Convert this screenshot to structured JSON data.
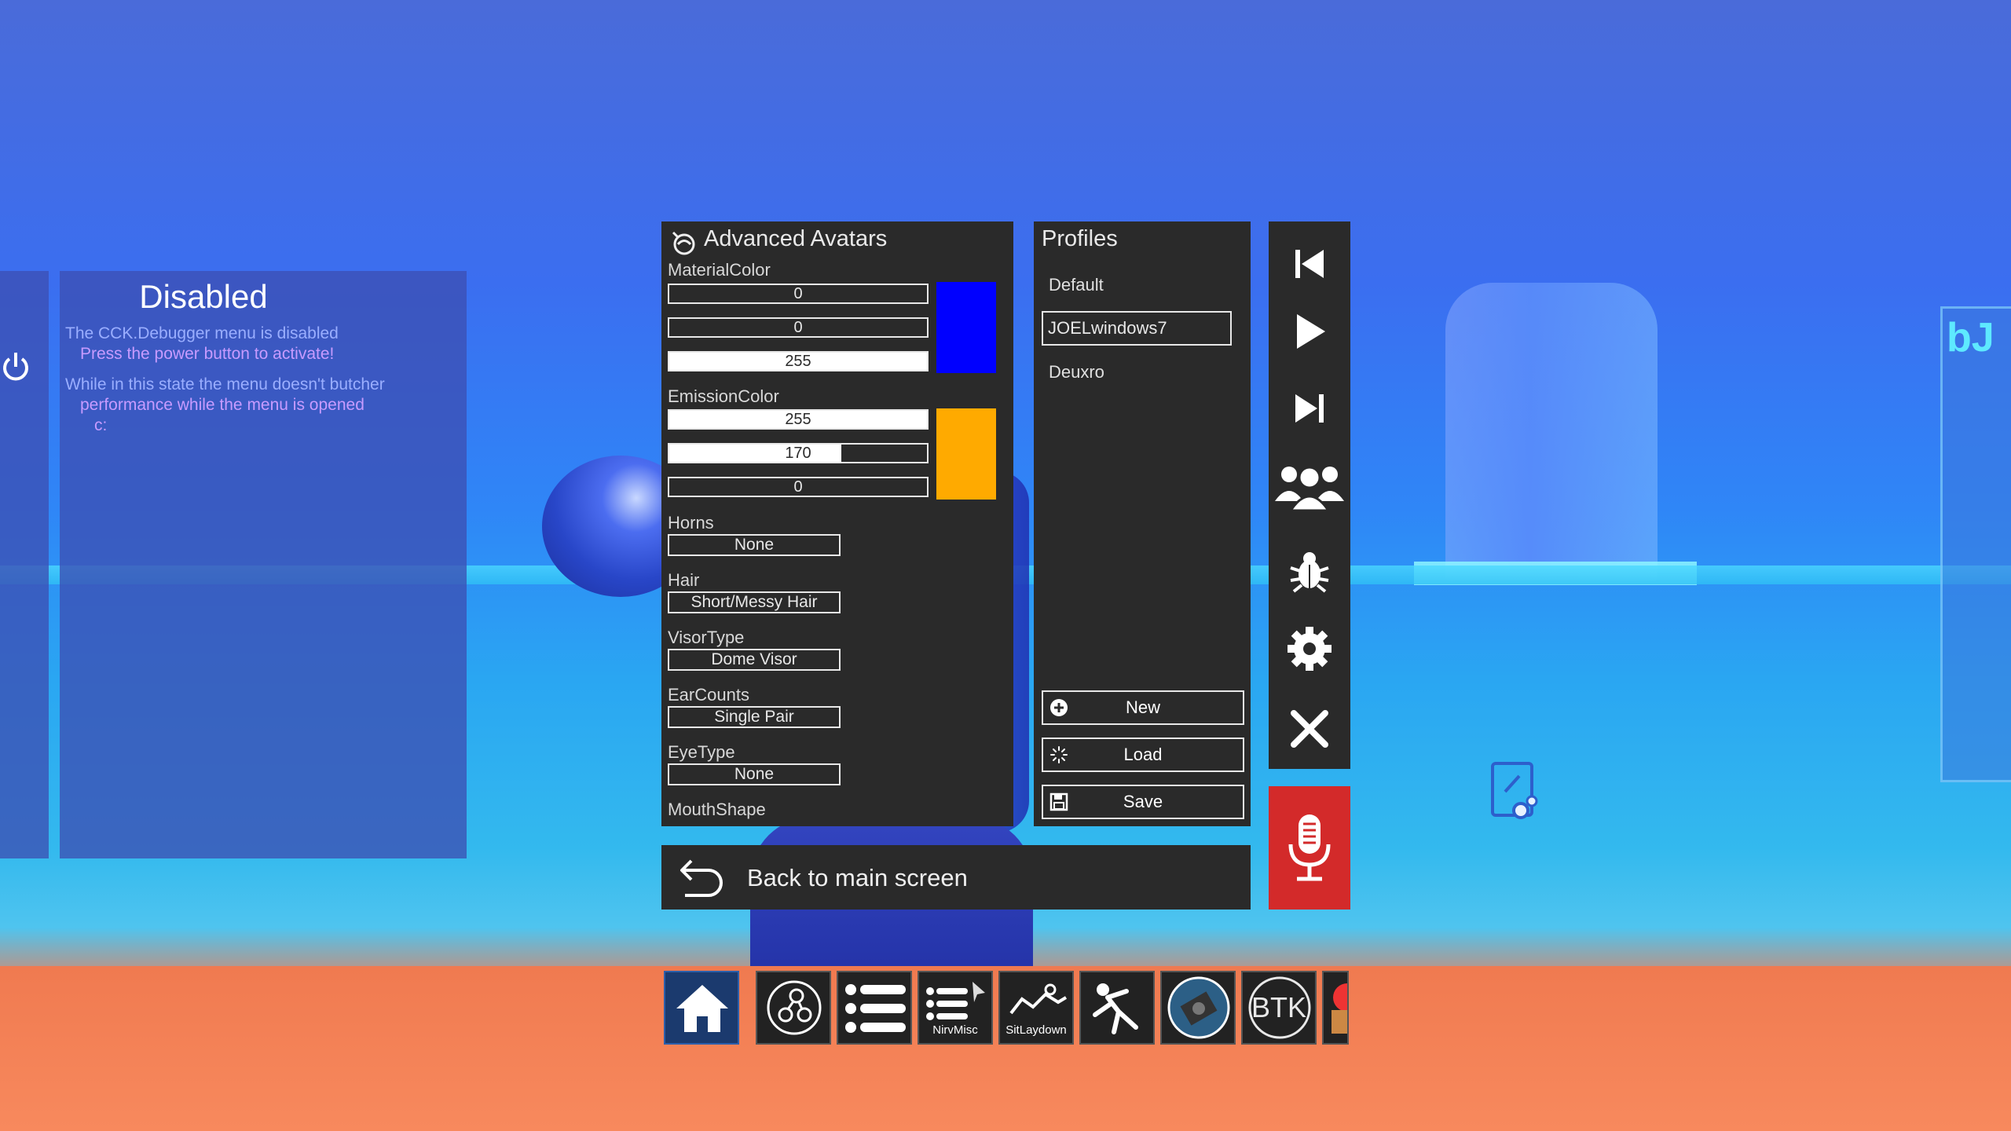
{
  "debugger": {
    "title": "Disabled",
    "line1": "The CCK.Debugger menu is disabled",
    "line2": "Press the power button to activate!",
    "line3": "While in this state the menu doesn't butcher",
    "line4": "performance while the menu is opened",
    "line5": "c:"
  },
  "advanced_avatars": {
    "title": "Advanced Avatars",
    "material_color": {
      "label": "MaterialColor",
      "r": "0",
      "g": "0",
      "b": "255",
      "r_frac": 0,
      "g_frac": 0,
      "b_frac": 1.0,
      "swatch": "#0000ff"
    },
    "emission_color": {
      "label": "EmissionColor",
      "r": "255",
      "g": "170",
      "b": "0",
      "r_frac": 1.0,
      "g_frac": 0.667,
      "b_frac": 0,
      "swatch": "#ffaa00"
    },
    "horns": {
      "label": "Horns",
      "value": "None"
    },
    "hair": {
      "label": "Hair",
      "value": "Short/Messy Hair"
    },
    "visor": {
      "label": "VisorType",
      "value": "Dome Visor"
    },
    "ears": {
      "label": "EarCounts",
      "value": "Single Pair"
    },
    "eye": {
      "label": "EyeType",
      "value": "None"
    },
    "mouth": {
      "label": "MouthShape"
    }
  },
  "profiles": {
    "title": "Profiles",
    "items": [
      "Default",
      "JOELwindows7",
      "Deuxro"
    ],
    "new_label": "New",
    "load_label": "Load",
    "save_label": "Save"
  },
  "back": {
    "label": "Back to main screen"
  },
  "toolbar": {
    "icons": [
      "skip-back-icon",
      "play-icon",
      "skip-forward-icon",
      "friends-icon",
      "bug-icon",
      "gear-icon",
      "close-icon",
      "microphone-icon"
    ],
    "mic_color": "#d32a2a"
  },
  "dock": {
    "items": [
      {
        "name": "home-icon"
      },
      {
        "name": "nodes-icon"
      },
      {
        "name": "list-icon"
      },
      {
        "name": "nirvmisc-icon",
        "label": "NirvMisc"
      },
      {
        "name": "sitlaydown-icon",
        "label": "SitLaydown"
      },
      {
        "name": "fall-icon"
      },
      {
        "name": "camera-icon"
      },
      {
        "name": "btk-icon",
        "label": "BTK"
      }
    ]
  }
}
